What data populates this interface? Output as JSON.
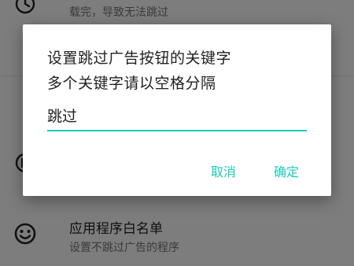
{
  "colors": {
    "accent": "#1cc9b9",
    "icon": "#212121"
  },
  "settings_list": {
    "items": [
      {
        "icon": "clock-icon",
        "title": "",
        "subtitle": "载完，导致无法跳过"
      },
      {
        "icon": "sync-icon",
        "title": "",
        "subtitle": ""
      },
      {
        "icon": "smiley-icon",
        "title": "应用程序白名单",
        "subtitle": "设置不跳过广告的程序"
      }
    ]
  },
  "dialog": {
    "message_line1": "设置跳过广告按钮的关键字",
    "message_line2": "多个关键字请以空格分隔",
    "keyword_input": {
      "value": "跳过"
    },
    "cancel_label": "取消",
    "confirm_label": "确定"
  }
}
